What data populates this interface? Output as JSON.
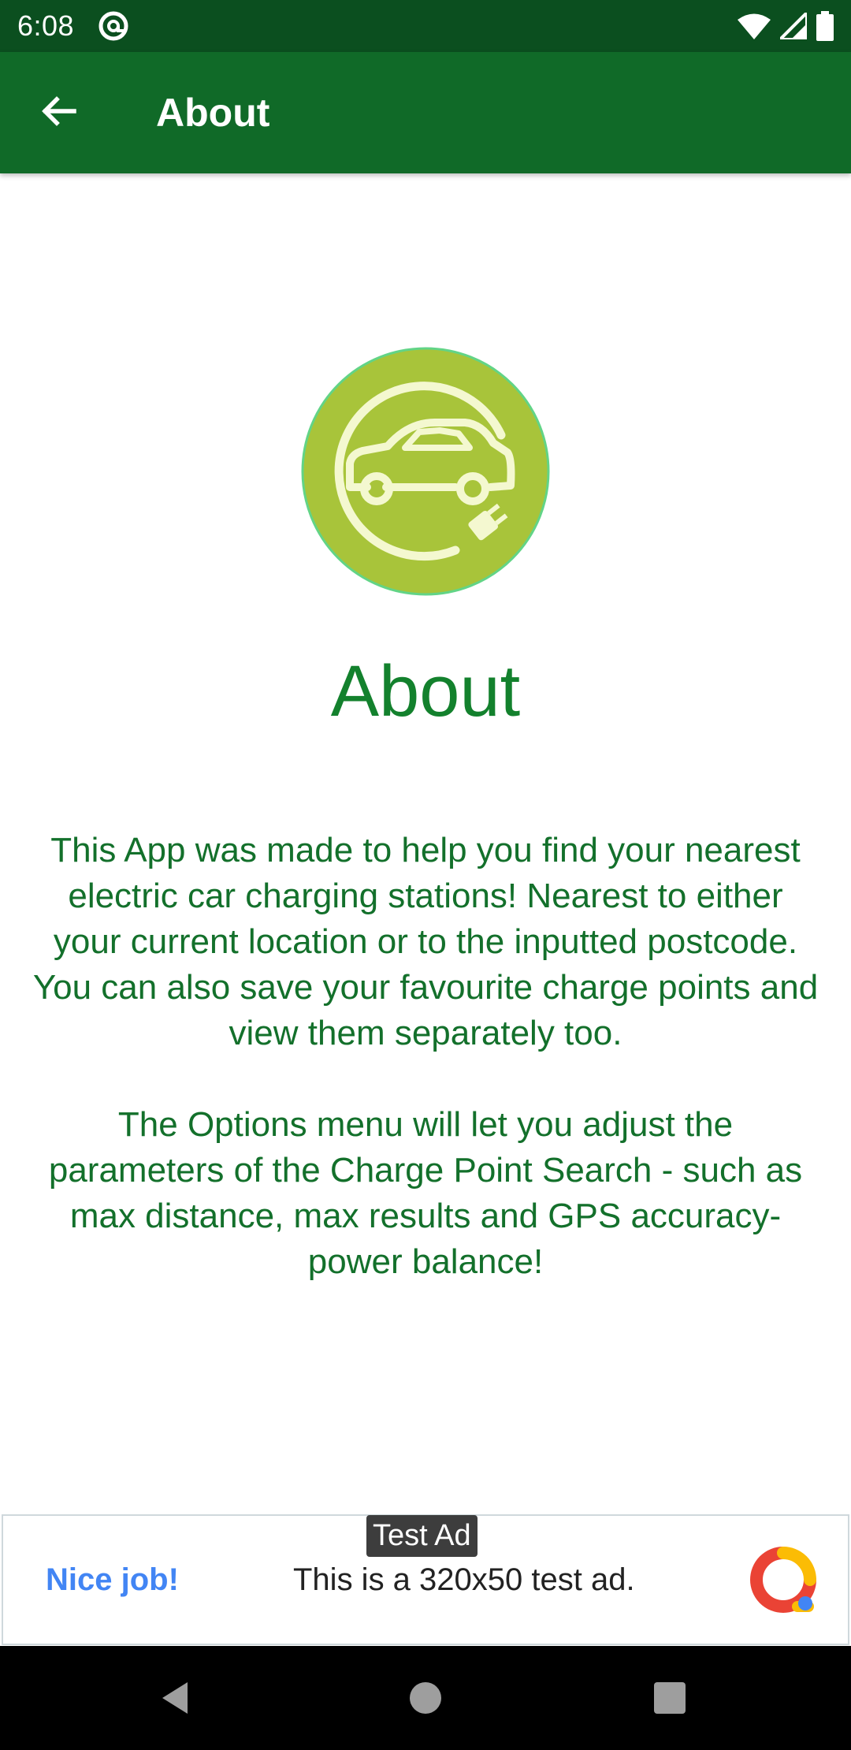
{
  "status_bar": {
    "time": "6:08",
    "icons": [
      "at-sign-icon",
      "wifi-icon",
      "signal-icon",
      "battery-icon"
    ]
  },
  "app_bar": {
    "back_icon": "arrow-left-icon",
    "title": "About"
  },
  "main": {
    "logo_icon": "ev-charging-car-icon",
    "heading": "About",
    "paragraphs": [
      "This App was made to help you find your nearest electric car charging stations! Nearest to either your current location or to the inputted postcode. You can also save your favourite charge points and view them separately too.",
      "The Options menu will let you adjust the parameters of the Charge Point Search - such as max distance, max results and GPS accuracy-power balance!"
    ]
  },
  "ad": {
    "tag": "Test Ad",
    "headline": "Nice job!",
    "body": "This is a 320x50 test ad.",
    "logo_icon": "ad-logo-icon"
  },
  "nav_bar": {
    "icons": [
      "nav-back-icon",
      "nav-home-icon",
      "nav-recents-icon"
    ]
  },
  "colors": {
    "status_bar": "#0b4f1f",
    "app_bar": "#106a28",
    "heading_green": "#13812d",
    "text_green": "#13702b",
    "logo_circle": "#a8c43a",
    "logo_line": "#f4f8d0",
    "ad_blue": "#4285f4"
  }
}
